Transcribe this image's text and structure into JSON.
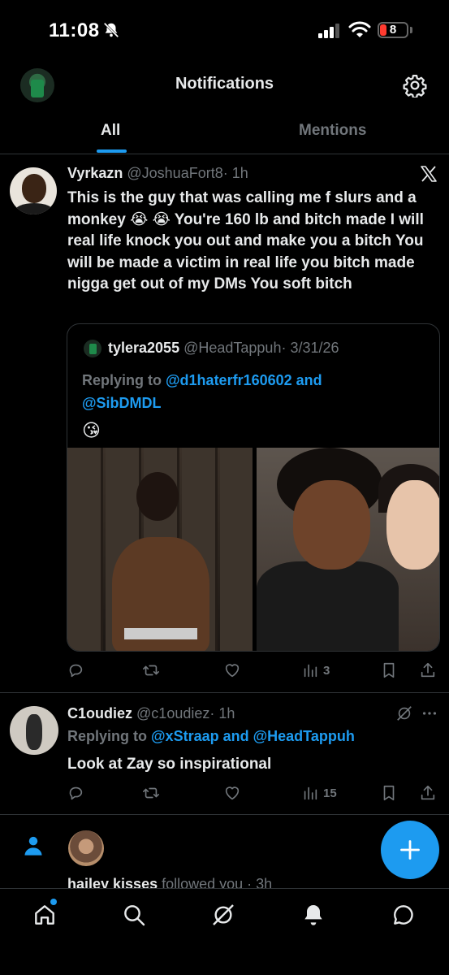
{
  "status_bar": {
    "time": "11:08",
    "battery": "8"
  },
  "header": {
    "title": "Notifications"
  },
  "tabs": [
    {
      "label": "All",
      "active": true
    },
    {
      "label": "Mentions",
      "active": false
    }
  ],
  "tweet1": {
    "name": "Vyrkazn",
    "handle": "@JoshuaFort8",
    "time": "· 1h",
    "body": "This is the guy that was calling me f slurs and a monkey 😭 😭  You're 160 lb and bitch made I will real life knock you out and make you a bitch You will be made a victim in real life you bitch made nigga get out of my DMs You soft bitch",
    "quote": {
      "name": "tylera2055",
      "handle": "@HeadTappuh",
      "time": "· 3/31/26",
      "replying_prefix": "Replying to ",
      "replying_to_1": "@d1haterfr160602",
      "replying_and": " and",
      "replying_to_2": "@SibDMDL",
      "emoji": "😘"
    },
    "views": "3"
  },
  "tweet2": {
    "name": "C1oudiez",
    "handle": "@c1oudiez",
    "time": "· 1h",
    "replying_prefix": "Replying to ",
    "replying_to_1": "@xStraap",
    "replying_and": " and ",
    "replying_to_2": "@HeadTappuh",
    "body": "Look at Zay so inspirational",
    "views": "15"
  },
  "follow": {
    "name": "hailey kisses",
    "text": " followed you",
    "time": " · 3h"
  },
  "colors": {
    "accent": "#1d9bf0",
    "muted": "#71767b",
    "text": "#e7e9ea",
    "background": "#000000"
  },
  "icons": [
    "bell-slash-icon",
    "signal-icon",
    "wifi-icon",
    "battery-icon",
    "settings-icon",
    "x-logo-icon",
    "reply-icon",
    "retweet-icon",
    "like-icon",
    "views-icon",
    "bookmark-icon",
    "share-icon",
    "grok-icon",
    "more-icon",
    "person-icon",
    "plus-icon",
    "home-icon",
    "search-icon",
    "grok-nav-icon",
    "notifications-icon",
    "messages-icon"
  ]
}
